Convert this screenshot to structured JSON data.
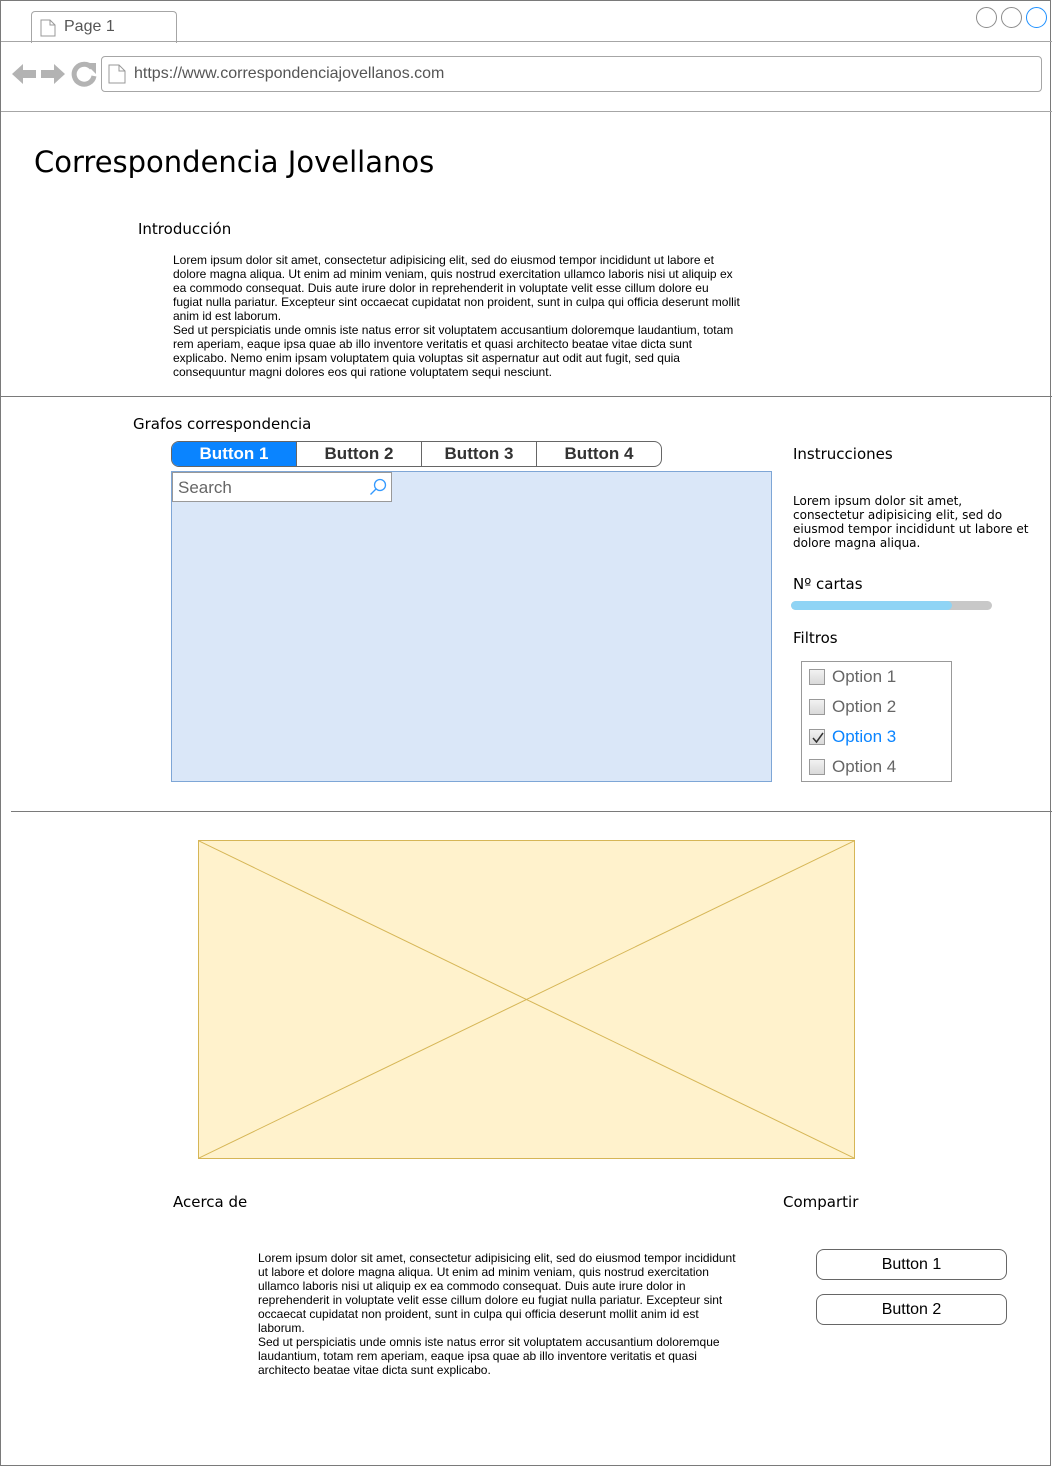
{
  "browser": {
    "tab_label": "Page 1",
    "url": "https://www.correspondenciajovellanos.com"
  },
  "page": {
    "title": "Correspondencia Jovellanos"
  },
  "intro": {
    "heading": "Introducción",
    "text": "Lorem ipsum dolor sit amet, consectetur adipisicing elit, sed do eiusmod tempor incididunt ut labore et\ndolore magna aliqua. Ut enim ad minim veniam, quis nostrud exercitation ullamco laboris nisi ut aliquip ex\nea commodo consequat. Duis aute irure dolor in reprehenderit in voluptate velit esse cillum dolore eu\nfugiat nulla pariatur. Excepteur sint occaecat cupidatat non proident, sunt in culpa qui officia deserunt mollit\nanim id est laborum.\nSed ut perspiciatis unde omnis iste natus error sit voluptatem accusantium doloremque laudantium, totam\nrem aperiam, eaque ipsa quae ab illo inventore veritatis et quasi architecto beatae vitae dicta sunt\nexplicabo. Nemo enim ipsam voluptatem quia voluptas sit aspernatur aut odit aut fugit, sed quia\nconsequuntur magni dolores eos qui ratione voluptatem sequi nesciunt."
  },
  "graphs": {
    "heading": "Grafos correspondencia",
    "tabs": [
      "Button 1",
      "Button 2",
      "Button 3",
      "Button 4"
    ],
    "active_tab": 0,
    "search_placeholder": "Search"
  },
  "sidebar": {
    "instructions_heading": "Instrucciones",
    "instructions_text": "Lorem ipsum dolor sit amet,\nconsectetur adipisicing elit, sed do\neiusmod tempor incididunt ut labore et\ndolore magna aliqua.",
    "count_label": "Nº cartas",
    "count_progress": 0.8,
    "filters_label": "Filtros",
    "options": [
      {
        "label": "Option 1",
        "checked": false
      },
      {
        "label": "Option 2",
        "checked": false
      },
      {
        "label": "Option 3",
        "checked": true
      },
      {
        "label": "Option 4",
        "checked": false
      }
    ]
  },
  "about": {
    "heading": "Acerca de",
    "text": "Lorem ipsum dolor sit amet, consectetur adipisicing elit, sed do eiusmod tempor incididunt\nut labore et dolore magna aliqua. Ut enim ad minim veniam, quis nostrud exercitation\nullamco laboris nisi ut aliquip ex ea commodo consequat. Duis aute irure dolor in\nreprehenderit in voluptate velit esse cillum dolore eu fugiat nulla pariatur. Excepteur sint\noccaecat cupidatat non proident, sunt in culpa qui officia deserunt mollit anim id est\nlaborum.\nSed ut perspiciatis unde omnis iste natus error sit voluptatem accusantium doloremque\nlaudantium, totam rem aperiam, eaque ipsa quae ab illo inventore veritatis et quasi\narchitecto beatae vitae dicta sunt explicabo."
  },
  "share": {
    "heading": "Compartir",
    "buttons": [
      "Button 1",
      "Button 2"
    ]
  },
  "colors": {
    "accent": "#0a84ff",
    "graph_bg": "#dae7f8",
    "image_placeholder_bg": "#fff2cc",
    "image_placeholder_border": "#d6b656",
    "progress_fill": "#8fd4f5"
  }
}
